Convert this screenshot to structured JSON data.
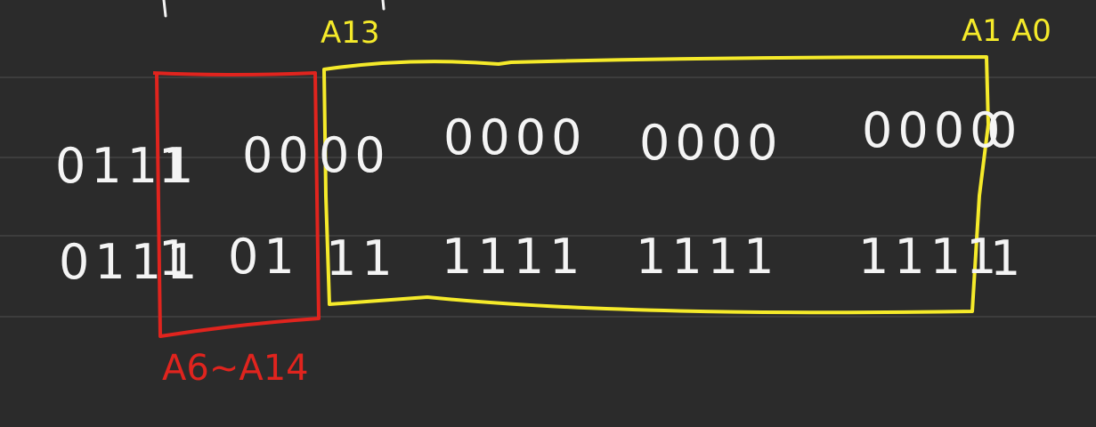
{
  "labels": {
    "a13": "A13",
    "a1": "A1",
    "a0": "A0",
    "a6_a14": "A6~A14"
  },
  "rows": [
    {
      "prefix": "0111",
      "red_bit": "1",
      "red_group": "00",
      "yellow_lead": "00",
      "groups": [
        "0000",
        "0000",
        "0000"
      ],
      "last": "0"
    },
    {
      "prefix": "0111",
      "red_bit": "1",
      "red_group": "01",
      "yellow_lead": "11",
      "groups": [
        "1111",
        "1111",
        "1111"
      ],
      "last": "1"
    }
  ],
  "colors": {
    "background": "#2b2b2b",
    "ink": "#f4f4f4",
    "yellow": "#f5ea2a",
    "red": "#e0241e"
  }
}
